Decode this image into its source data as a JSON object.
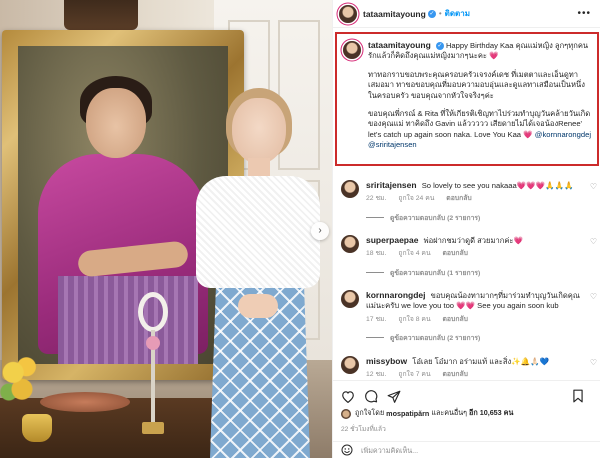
{
  "post": {
    "username": "tataamitayoung",
    "follow_label": "ติดตาม",
    "more_label": "•••",
    "carousel_next": "›"
  },
  "caption": {
    "username": "tataamitayoung",
    "p1": "Happy Birthday Kaa คุณแม่หญิง ลูกๆทุกคนรักแล้วก็คิดถึงคุณแม่หญิงมากๆนะคะ",
    "p1_heart": "💗",
    "p2": "ทาทอกราบขอบพระคุณครอบครัวเจรงค์เดช ที่เมตตาและเอ็นดูทาเสมอมา ทาขอขอบคุณที่มอบความอบอุ่นและดูแลทาเสมือนเป็นหนึ่งในครอบครัว ขอบคุณจากหัวใจจริงๆค่ะ",
    "p3_a": "ขอบคุณพี่กรณ์ & Rita ที่ให้เกียรติเชิญทาไปร่วมทำบุญวันคล้ายวันเกิดของคุณแม่ ทาคิดถึง Gavin แล้ววววว เสียดายไม่ได้เจอน้องRenee' let's catch up again soon naka. Love You Kaa",
    "p3_heart": "💗",
    "mention1": "@kornnarongdej",
    "mention2": "@sriritajensen",
    "time": "22 ชม."
  },
  "comments": [
    {
      "username": "sriritajensen",
      "text": "So lovely to see you nakaaa💗💗💗🙏🙏🙏",
      "time": "22 ชม.",
      "likes": "ถูกใจ 24 คน",
      "reply": "ตอบกลับ",
      "view_replies": "ดูข้อความตอบกลับ (2 รายการ)"
    },
    {
      "username": "superpaepae",
      "text": "พ่อฝากชมว่าดูดี สวยมากค่ะ💗",
      "time": "18 ชม.",
      "likes": "ถูกใจ 4 คน",
      "reply": "ตอบกลับ",
      "view_replies": "ดูข้อความตอบกลับ (1 รายการ)"
    },
    {
      "username": "kornnarongdej",
      "text": "ขอบคุณน้องทามากๆที่มาร่วมทำบุญวันเกิดคุณแม่นะครับ we love you too 💗💗 See you again soon kub",
      "time": "17 ชม.",
      "likes": "ถูกใจ 8 คน",
      "reply": "ตอบกลับ",
      "view_replies": "ดูข้อความตอบกลับ (2 รายการ)"
    },
    {
      "username": "missybow",
      "text": "โอ๋เลย โอ๋มาก อร่ามแท้ และสิ่ง✨🔔🙏🏻💙",
      "time": "12 ชม.",
      "likes": "ถูกใจ 7 คน",
      "reply": "ตอบกลับ"
    }
  ],
  "likes": {
    "prefix": "ถูกใจโดย",
    "user": "mospatipărn",
    "middle": "และคนอื่นๆ",
    "count": "อีก 10,653 คน"
  },
  "post_time": "22 ชั่วโมงที่แล้ว",
  "add_comment": {
    "placeholder": "เพิ่มความคิดเห็น..."
  },
  "icons": {
    "heart": "heart-icon",
    "comment": "comment-icon",
    "share": "share-icon",
    "save": "bookmark-icon",
    "emoji": "emoji-icon"
  },
  "colors": {
    "highlight_border": "#cc2b2b",
    "follow_blue": "#0095f6",
    "verified_blue": "#3897f0",
    "heart_red": "#ed4956"
  }
}
